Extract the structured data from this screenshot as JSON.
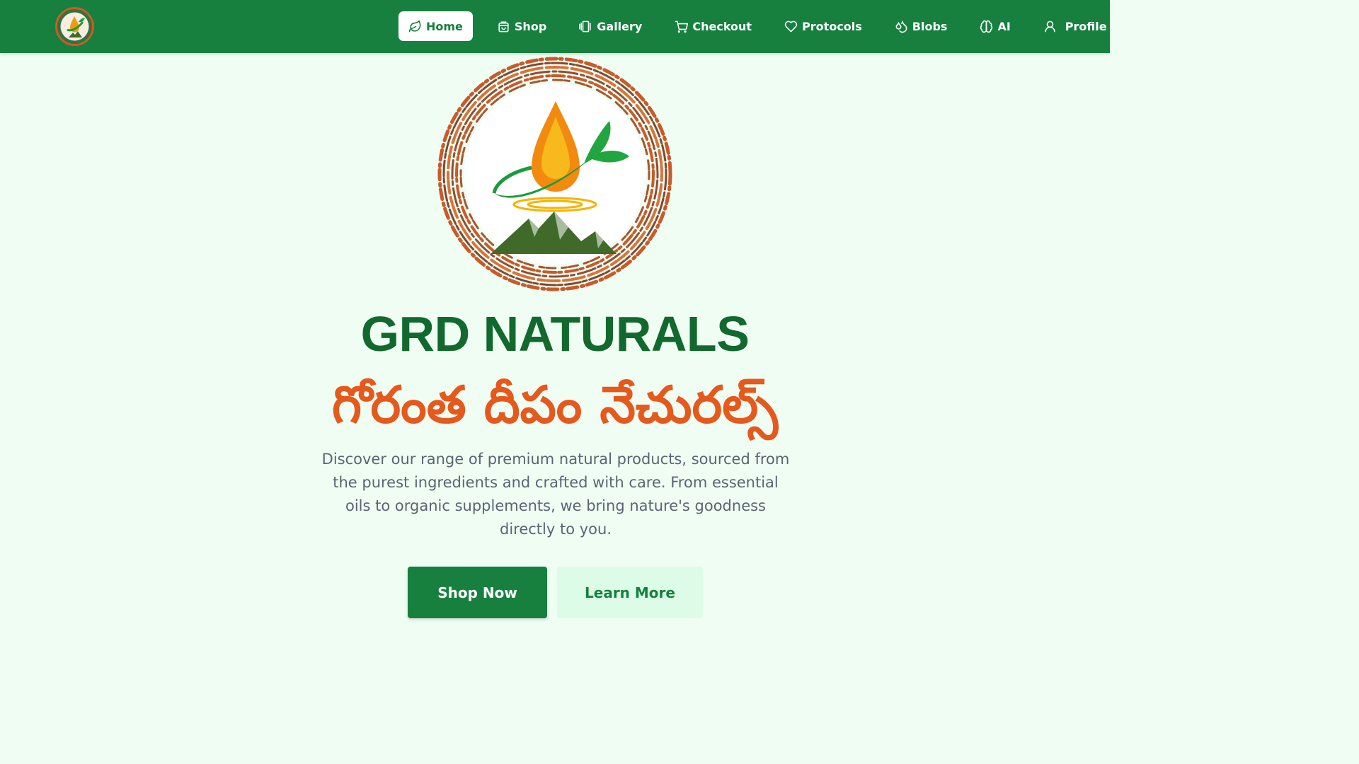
{
  "nav": {
    "items": [
      {
        "label": "Home",
        "icon": "leaf-icon",
        "active": true
      },
      {
        "label": "Shop",
        "icon": "shopping-bag-icon"
      },
      {
        "label": "Gallery",
        "icon": "gallery-icon"
      },
      {
        "label": "Checkout",
        "icon": "cart-icon"
      },
      {
        "label": "Protocols",
        "icon": "heart-icon"
      },
      {
        "label": "Blobs",
        "icon": "droplets-icon"
      },
      {
        "label": "AI",
        "icon": "brain-icon"
      },
      {
        "label": "Profile",
        "icon": "user-icon"
      }
    ]
  },
  "hero": {
    "title": "GRD NATURALS",
    "telugu_title": "గోరంత దీపం నేచురల్స్",
    "description": "Discover our range of premium natural products, sourced from the purest ingredients and crafted with care. From essential oils to organic supplements, we bring nature's goodness directly to you.",
    "primary_button": "Shop Now",
    "secondary_button": "Learn More"
  },
  "colors": {
    "nav_bg": "#17803f",
    "page_bg": "#effdf3",
    "title_green": "#12692d",
    "telugu_orange": "#e5591d",
    "button_green": "#17803f",
    "button_light": "#dcfce7"
  }
}
